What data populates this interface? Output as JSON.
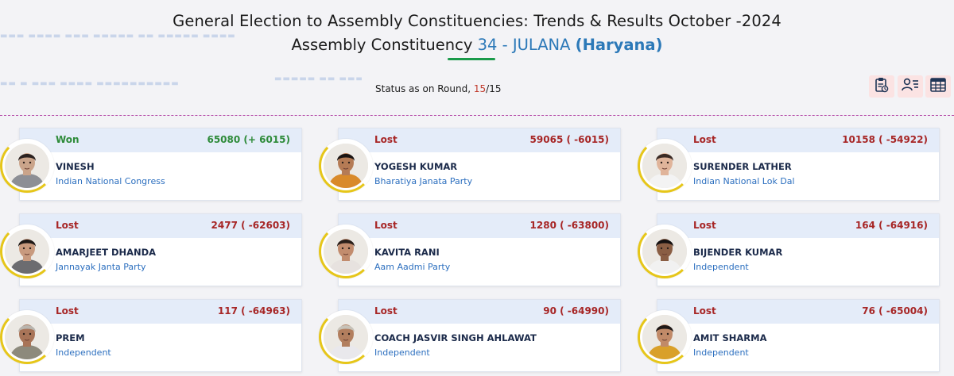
{
  "header": {
    "title_line1": "General Election to Assembly Constituencies: Trends & Results October -2024",
    "ac_prefix": "Assembly Constituency",
    "ac_number": "34 - JULANA",
    "ac_state": "(Haryana)"
  },
  "status": {
    "label": "Status as on Round,",
    "current_round": "15",
    "separator": "/",
    "total_rounds": "15"
  },
  "toolbar": {
    "icons": [
      "report-icon",
      "candidate-list-icon",
      "table-view-icon"
    ]
  },
  "colors": {
    "won": "#2e8b3a",
    "lost": "#a72626",
    "accent_blue": "#2c79b8",
    "status_red": "#c0392b",
    "divider": "#b44aa8"
  },
  "candidates": [
    {
      "result": "Won",
      "votes": "65080 (+ 6015)",
      "name": "VINESH",
      "party": "Indian National Congress",
      "skin": "#caa48a",
      "hair": "#2b2220",
      "shirt": "#8d8f95"
    },
    {
      "result": "Lost",
      "votes": "59065 ( -6015)",
      "name": "YOGESH KUMAR",
      "party": "Bharatiya Janata Party",
      "skin": "#b57b55",
      "hair": "#1a1412",
      "shirt": "#d98a2a"
    },
    {
      "result": "Lost",
      "votes": "10158 ( -54922)",
      "name": "SURENDER LATHER",
      "party": "Indian National Lok Dal",
      "skin": "#e0b49a",
      "hair": "#3a2a24",
      "shirt": "#f3f3f3"
    },
    {
      "result": "Lost",
      "votes": "2477 ( -62603)",
      "name": "AMARJEET DHANDA",
      "party": "Jannayak Janta Party",
      "skin": "#c89a7e",
      "hair": "#1e1917",
      "shirt": "#6c6c70"
    },
    {
      "result": "Lost",
      "votes": "1280 ( -63800)",
      "name": "KAVITA RANI",
      "party": "Aam Aadmi Party",
      "skin": "#c28c6e",
      "hair": "#2a1f1a",
      "shirt": "#e7e2df"
    },
    {
      "result": "Lost",
      "votes": "164 ( -64916)",
      "name": "BIJENDER KUMAR",
      "party": "Independent",
      "skin": "#8a5e44",
      "hair": "#151111",
      "shirt": "#f1f1f1"
    },
    {
      "result": "Lost",
      "votes": "117 ( -64963)",
      "name": "PREM",
      "party": "Independent",
      "skin": "#a87458",
      "hair": "#b9b5ae",
      "shirt": "#8d8a7c"
    },
    {
      "result": "Lost",
      "votes": "90 ( -64990)",
      "name": "COACH JASVIR SINGH AHLAWAT",
      "party": "Independent",
      "skin": "#b27e5e",
      "hair": "#c7c2b8",
      "shirt": "#e9e8ec"
    },
    {
      "result": "Lost",
      "votes": "76 ( -65004)",
      "name": "AMIT SHARMA",
      "party": "Independent",
      "skin": "#c18a68",
      "hair": "#1f1816",
      "shirt": "#d9a02a"
    }
  ]
}
